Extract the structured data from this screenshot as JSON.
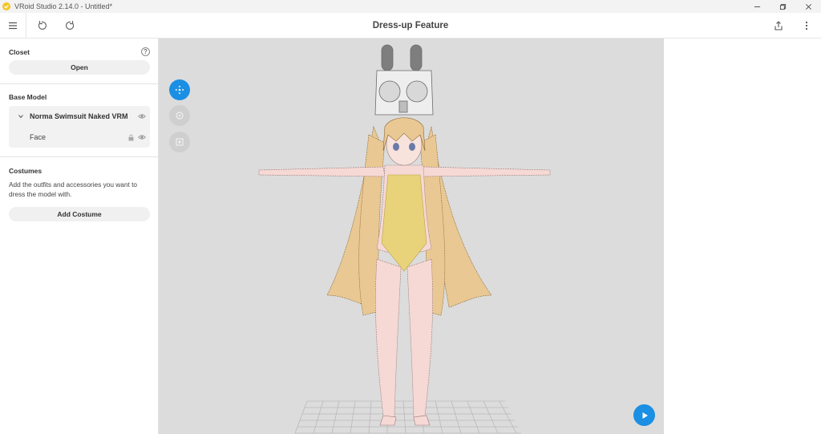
{
  "window": {
    "title": "VRoid Studio 2.14.0 - Untitled*",
    "icon": "vroid-check-icon",
    "controls": [
      "minimize-icon",
      "restore-icon",
      "close-icon"
    ]
  },
  "toolbar": {
    "title": "Dress-up Feature",
    "left_icons": [
      "menu-icon",
      "undo-icon",
      "redo-icon"
    ],
    "right_icons": [
      "share-icon",
      "more-vertical-icon"
    ]
  },
  "sidebar": {
    "closet": {
      "label": "Closet",
      "help_icon": "?",
      "open_button": "Open"
    },
    "base_model": {
      "label": "Base Model",
      "model_name": "Norma Swimsuit Naked VRM",
      "child_item": "Face"
    },
    "costumes": {
      "label": "Costumes",
      "description": "Add the outfits and accessories you want to dress the model with.",
      "add_button": "Add Costume"
    }
  },
  "viewport": {
    "tools": [
      "move-tool-icon",
      "rotate-tool-icon",
      "frame-tool-icon"
    ],
    "play_icon": "play-icon"
  },
  "colors": {
    "accent": "#1a8fe3",
    "viewport_bg": "#dcdcdc",
    "title_bar_bg": "#f3f3f3"
  }
}
